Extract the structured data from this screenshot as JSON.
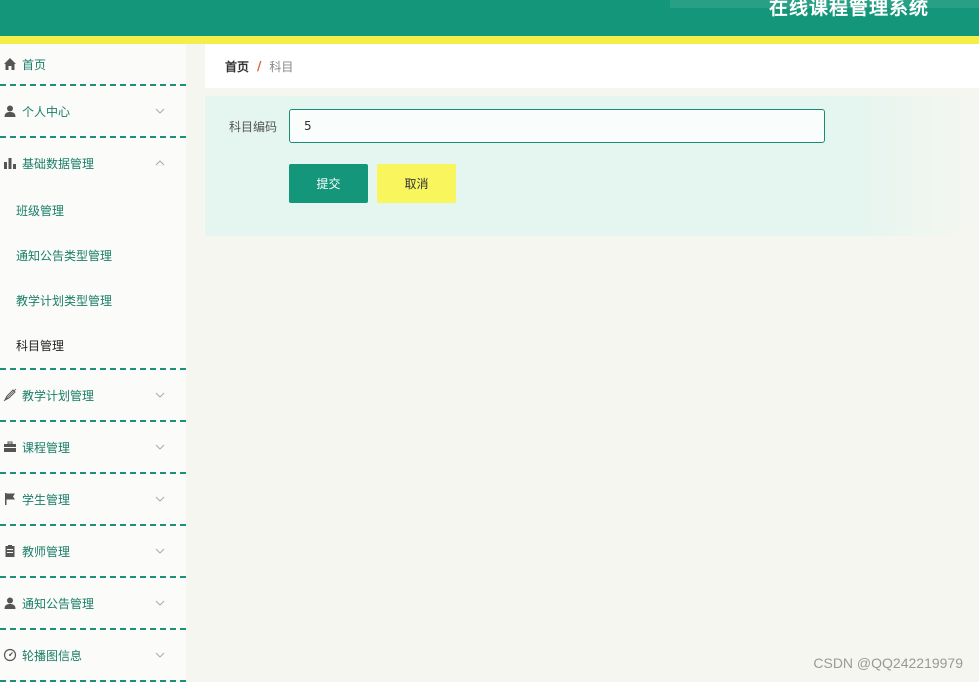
{
  "header": {
    "title": "在线课程管理系统"
  },
  "sidebar": {
    "items": [
      {
        "label": "首页",
        "icon": "home-icon"
      },
      {
        "label": "个人中心",
        "icon": "user-icon"
      },
      {
        "label": "基础数据管理",
        "icon": "bar-chart-icon",
        "children": [
          "班级管理",
          "通知公告类型管理",
          "教学计划类型管理",
          "科目管理"
        ]
      },
      {
        "label": "教学计划管理",
        "icon": "pen-icon"
      },
      {
        "label": "课程管理",
        "icon": "briefcase-icon"
      },
      {
        "label": "学生管理",
        "icon": "flag-icon"
      },
      {
        "label": "教师管理",
        "icon": "clipboard-icon"
      },
      {
        "label": "通知公告管理",
        "icon": "user-icon"
      },
      {
        "label": "轮播图信息",
        "icon": "gauge-icon"
      }
    ]
  },
  "breadcrumb": {
    "home": "首页",
    "separator": "/",
    "current": "科目"
  },
  "form": {
    "field_label": "科目编码",
    "field_value": "5",
    "submit_label": "提交",
    "cancel_label": "取消"
  },
  "watermark": "CSDN @QQ242219979",
  "colors": {
    "primary": "#14967a",
    "accent_yellow": "#f3ee48",
    "panel": "#e5f5ef"
  }
}
